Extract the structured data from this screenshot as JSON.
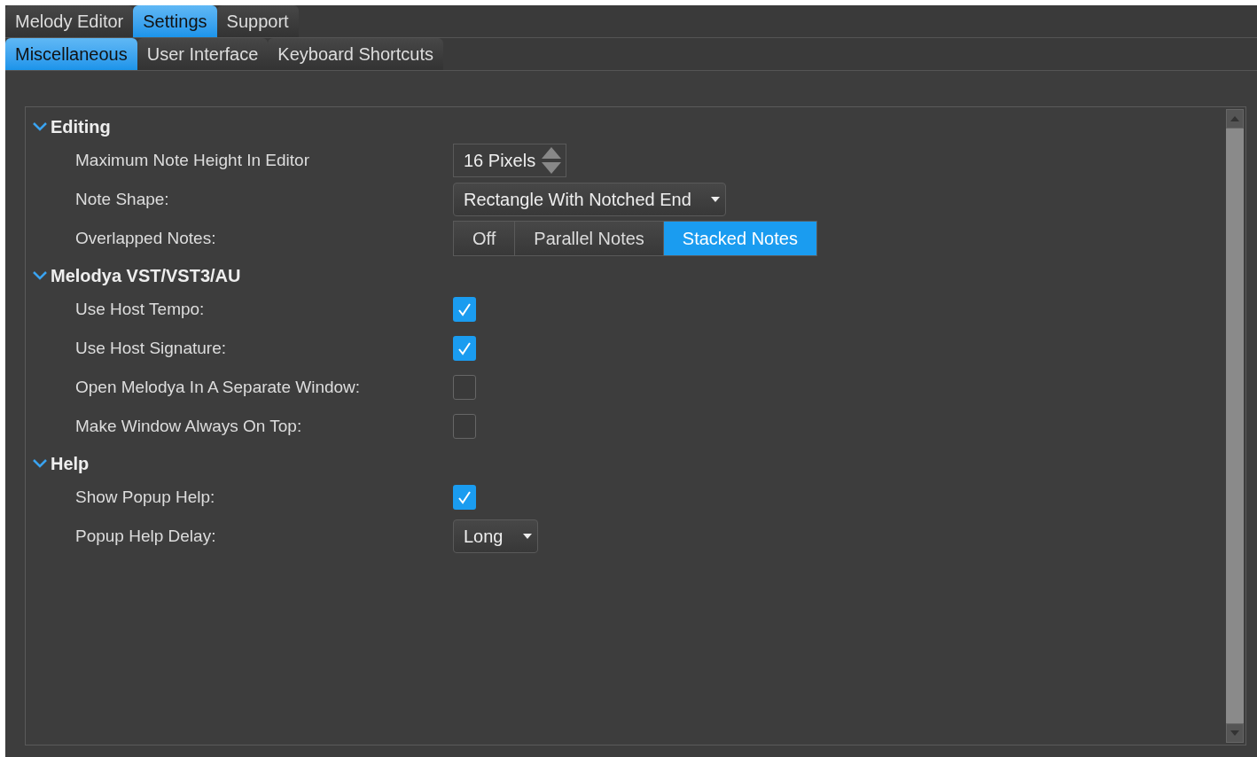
{
  "tabs": [
    {
      "label": "Melody Editor",
      "selected": false
    },
    {
      "label": "Settings",
      "selected": true
    },
    {
      "label": "Support",
      "selected": false
    }
  ],
  "subtabs": [
    {
      "label": "Miscellaneous",
      "selected": true
    },
    {
      "label": "User Interface",
      "selected": false
    },
    {
      "label": "Keyboard Shortcuts",
      "selected": false
    }
  ],
  "sections": [
    {
      "title": "Editing",
      "expanded": true,
      "rows": [
        {
          "kind": "spinner",
          "label": "Maximum Note Height In Editor",
          "value": "16 Pixels"
        },
        {
          "kind": "dropdown",
          "label": "Note Shape:",
          "value": "Rectangle With Notched End"
        },
        {
          "kind": "segmented",
          "label": "Overlapped Notes:",
          "options": [
            {
              "label": "Off",
              "selected": false
            },
            {
              "label": "Parallel Notes",
              "selected": false
            },
            {
              "label": "Stacked Notes",
              "selected": true
            }
          ]
        }
      ]
    },
    {
      "title": "Melodya VST/VST3/AU",
      "expanded": true,
      "rows": [
        {
          "kind": "checkbox",
          "label": "Use Host Tempo:",
          "checked": true
        },
        {
          "kind": "checkbox",
          "label": "Use Host Signature:",
          "checked": true
        },
        {
          "kind": "checkbox",
          "label": "Open Melodya In A Separate Window:",
          "checked": false
        },
        {
          "kind": "checkbox",
          "label": "Make Window Always On Top:",
          "checked": false
        }
      ]
    },
    {
      "title": "Help",
      "expanded": true,
      "rows": [
        {
          "kind": "checkbox",
          "label": "Show Popup Help:",
          "checked": true
        },
        {
          "kind": "dropdown",
          "label": "Popup Help Delay:",
          "value": "Long"
        }
      ]
    }
  ]
}
